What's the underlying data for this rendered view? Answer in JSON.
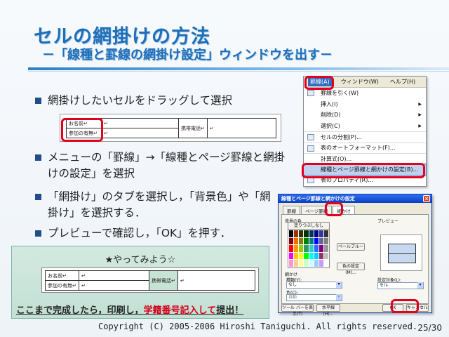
{
  "title": {
    "main": "セルの網掛けの方法",
    "sub": "－「線種と罫線の網掛け設定」ウィンドウを出す－"
  },
  "bullets": [
    "網掛けしたいセルをドラッグして選択",
    "メニューの「罫線」→「線種とページ罫線と網掛けの設定」を選択",
    "「網掛け」のタブを選択し，「背景色」や「網掛け」を選択する．",
    "プレビューで確認し，「OK」を押す．"
  ],
  "form_snippet": {
    "name_label": "お名前↵",
    "attend_label": "参加の有無↵",
    "phone_label": "携帯電話↵",
    "mark": "↵"
  },
  "practice": {
    "heading": "★やってみよう☆",
    "name_label": "お名前↵",
    "attend_label": "参加の有無↵",
    "phone_label": "携帯電話↵",
    "note_part1": "ここまで完成したら，印刷し，",
    "note_highlight": "学籍番号記入して",
    "note_part2": "提出！"
  },
  "menu": {
    "bar": [
      "罫線(A)",
      "ウィンドウ(W)",
      "ヘルプ(H)"
    ],
    "items": [
      {
        "label": "罫線を引く(W)",
        "arrow": ""
      },
      {
        "label": "挿入(I)",
        "arrow": "▶"
      },
      {
        "label": "削除(D)",
        "arrow": "▶"
      },
      {
        "label": "選択(C)",
        "arrow": "▶"
      },
      {
        "label": "セルの分割(P)...",
        "arrow": ""
      },
      {
        "label": "表のオートフォーマット(F)...",
        "arrow": ""
      },
      {
        "label": "計算式(O)...",
        "arrow": ""
      },
      {
        "label": "線種とページ罫線と網かけの設定(B)...",
        "arrow": ""
      },
      {
        "label": "表のプロパティ(R)...",
        "arrow": ""
      }
    ]
  },
  "dialog": {
    "title": "線種とページ罫線と網かけの設定",
    "close": "×",
    "tabs": [
      "罫線",
      "ページ罫線",
      "網かけ"
    ],
    "fill_label": "背景の色",
    "no_fill": "塗りつぶしなし",
    "pale_blue": "ペールブルー",
    "other_colors": "色の設定(M)...",
    "pattern_label": "網かけ",
    "style_label": "種類(Y):",
    "style_value": "なし",
    "color_label": "色(C):",
    "color_value": "自動",
    "preview_label": "プレビュー",
    "apply_label": "設定対象(L):",
    "apply_value": "セル",
    "toolbar_btn": "ツール バーを表示(T)",
    "hline_btn": "水平線(H)...",
    "ok": "OK",
    "cancel": "キャンセル"
  },
  "palette_colors": [
    "#000000",
    "#993300",
    "#333300",
    "#003300",
    "#003366",
    "#000080",
    "#333399",
    "#333333",
    "#800000",
    "#ff6600",
    "#808000",
    "#008000",
    "#008080",
    "#0000ff",
    "#666699",
    "#808080",
    "#ff0000",
    "#ff9900",
    "#99cc00",
    "#339966",
    "#33cccc",
    "#3366ff",
    "#800080",
    "#999999",
    "#ff00ff",
    "#ffcc00",
    "#ffff00",
    "#00ff00",
    "#00ffff",
    "#00ccff",
    "#993366",
    "#c0c0c0",
    "#ff99cc",
    "#ffcc99",
    "#ffff99",
    "#ccffcc",
    "#ccffff",
    "#99ccff",
    "#cc99ff",
    "#ffffff"
  ],
  "accent_red": "#e1001e",
  "footer": "Copyright (C) 2005-2006 Hiroshi Taniguchi. All rights reserved.",
  "page_number": "25/30"
}
